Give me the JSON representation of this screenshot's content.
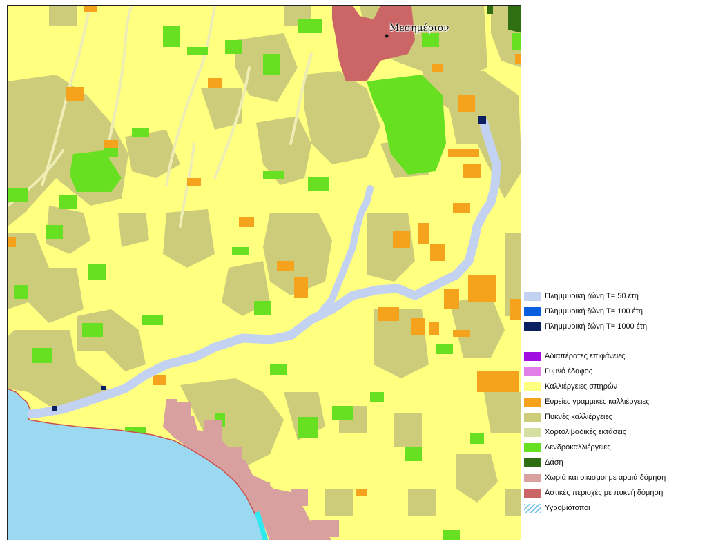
{
  "place_label": "Μεσημέριον",
  "flood_legend": [
    {
      "label": "Πλημμυρική ζώνη T= 50 έτη",
      "color": "#c4d2f2"
    },
    {
      "label": "Πλημμυρική ζώνη T= 100 έτη",
      "color": "#0a5fe0"
    },
    {
      "label": "Πλημμυρική ζώνη T= 1000 έτη",
      "color": "#0a2060"
    }
  ],
  "landuse_legend": [
    {
      "label": "Αδιαπέρατες επιφάνειες",
      "color": "#a00ee0"
    },
    {
      "label": "Γυμνό έδαφος",
      "color": "#e27ee8"
    },
    {
      "label": "Καλλιέργειες σπηρών",
      "color": "#ffff80"
    },
    {
      "label": "Ευρείες γραμμικές καλλιέργειες",
      "color": "#f5a21c"
    },
    {
      "label": "Πυκνές καλλιέργειες",
      "color": "#cccc7a"
    },
    {
      "label": "Χορτολιβαδικές εκτάσεις",
      "color": "#d6dea2"
    },
    {
      "label": "Δενδροκαλλιέργειες",
      "color": "#66e020"
    },
    {
      "label": "Δάση",
      "color": "#2f6e12"
    },
    {
      "label": "Χωριά και οικισμοί με αραιά δόμηση",
      "color": "#d9a0a0"
    },
    {
      "label": "Αστικές περιοχές με πυκνή δόμηση",
      "color": "#cc6666"
    },
    {
      "label": "Υγροβιότοποι",
      "color": "#7ec6e8",
      "pattern": "hatch"
    }
  ],
  "colors": {
    "background": "#ffff80",
    "sea": "#9ad9ef",
    "coast_line": "#cc5050",
    "stream": "#eeeeb4",
    "olive": "#cccc7a",
    "orange": "#f5a21c",
    "green": "#66e020",
    "forest": "#2f6e12",
    "urban": "#cc6666",
    "village": "#d9a0a0",
    "flood50": "#c4d2f2",
    "flood1000": "#0a2060",
    "wetland": "#30e8f0"
  }
}
